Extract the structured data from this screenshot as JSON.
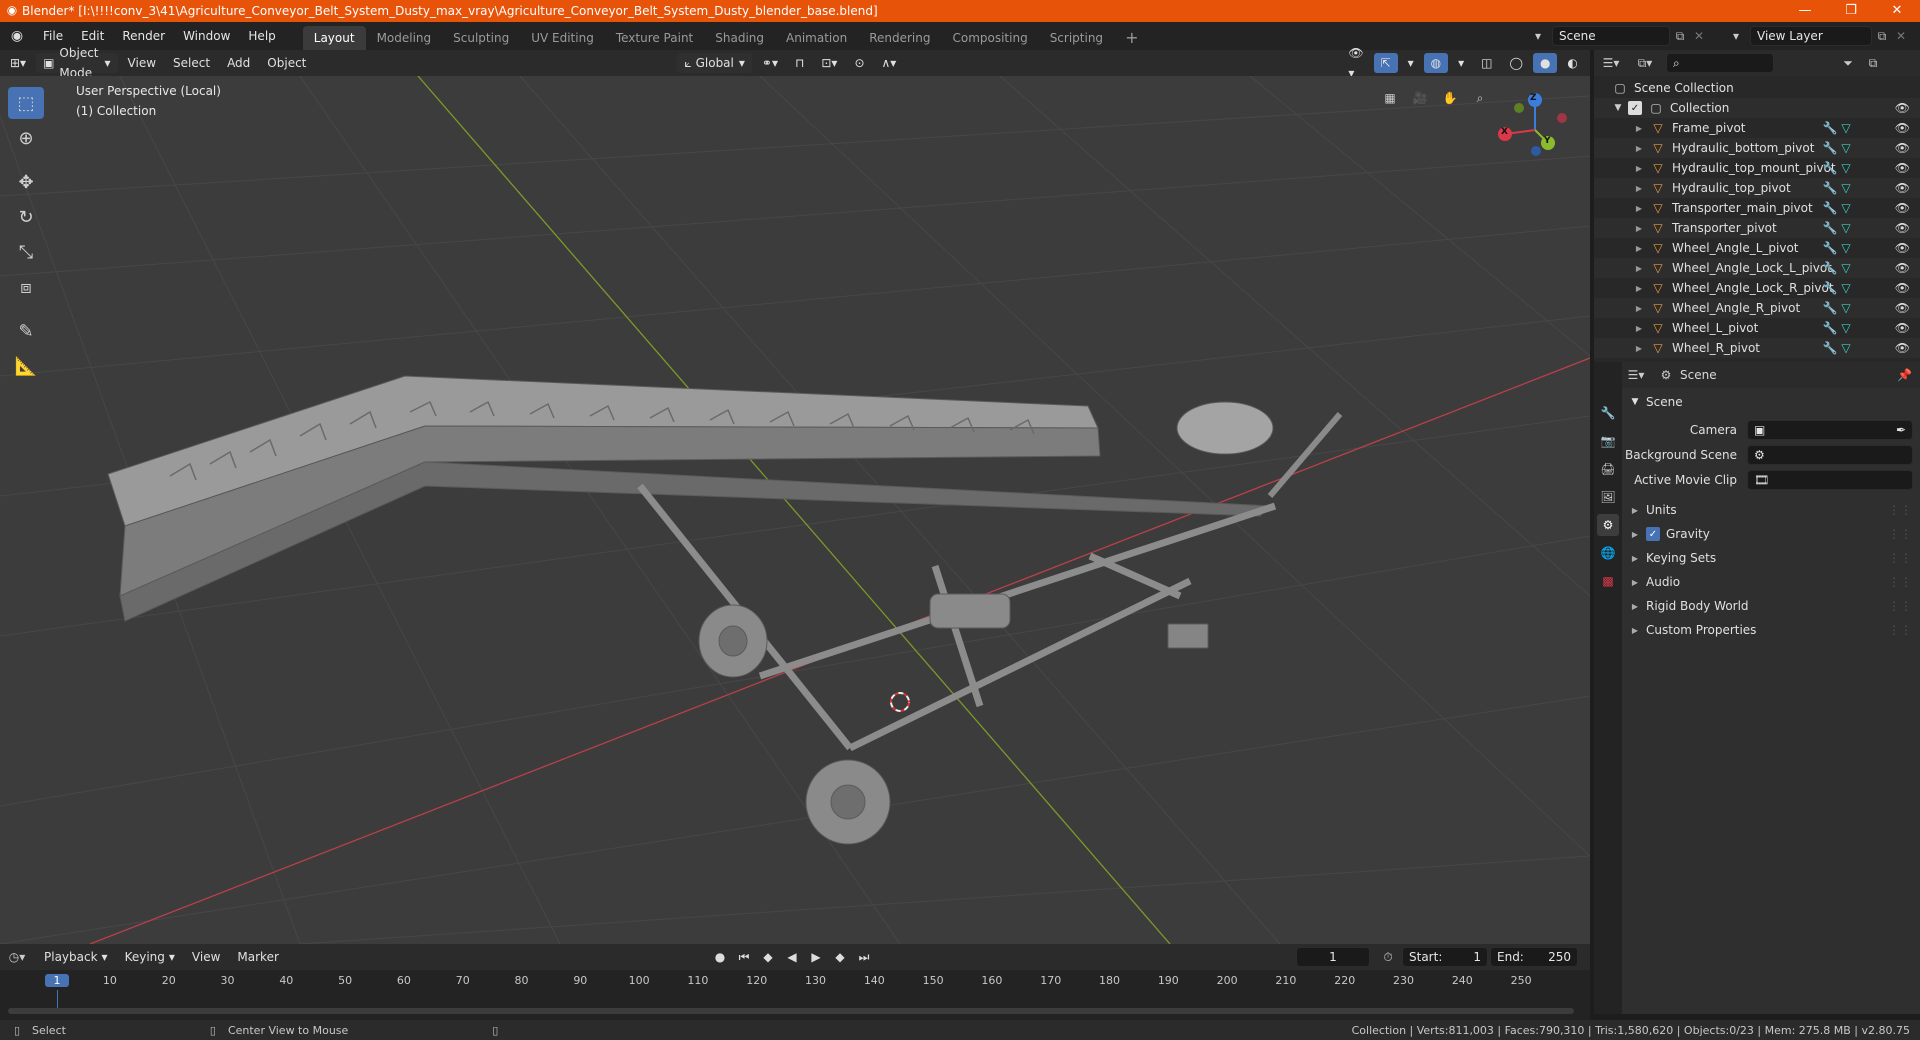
{
  "window": {
    "title": "Blender* [I:\\!!!!conv_3\\41\\Agriculture_Conveyor_Belt_System_Dusty_max_vray\\Agriculture_Conveyor_Belt_System_Dusty_blender_base.blend]",
    "minimize": "—",
    "restore": "❐",
    "close": "✕"
  },
  "menu": [
    "File",
    "Edit",
    "Render",
    "Window",
    "Help"
  ],
  "workspaces": [
    "Layout",
    "Modeling",
    "Sculpting",
    "UV Editing",
    "Texture Paint",
    "Shading",
    "Animation",
    "Rendering",
    "Compositing",
    "Scripting"
  ],
  "workspace_add": "+",
  "scene_field": "Scene",
  "view_layer_field": "View Layer",
  "viewport_header": {
    "mode": "Object Mode",
    "view": "View",
    "select": "Select",
    "add": "Add",
    "object": "Object",
    "transform": "Global"
  },
  "viewport": {
    "perspective": "User Perspective (Local)",
    "collection": "(1) Collection",
    "gizmo": {
      "x": "X",
      "y": "Y",
      "z": "Z"
    }
  },
  "outliner": {
    "root": "Scene Collection",
    "collection": "Collection",
    "items": [
      "Frame_pivot",
      "Hydraulic_bottom_pivot",
      "Hydraulic_top_mount_pivot",
      "Hydraulic_top_pivot",
      "Transporter_main_pivot",
      "Transporter_pivot",
      "Wheel_Angle_L_pivot",
      "Wheel_Angle_Lock_L_pivot",
      "Wheel_Angle_Lock_R_pivot",
      "Wheel_Angle_R_pivot",
      "Wheel_L_pivot",
      "Wheel_R_pivot"
    ]
  },
  "properties": {
    "header": "Scene",
    "panel": "Scene",
    "fields": [
      {
        "label": "Camera",
        "value": ""
      },
      {
        "label": "Background Scene",
        "value": ""
      },
      {
        "label": "Active Movie Clip",
        "value": ""
      }
    ],
    "sections": [
      "Units",
      "Gravity",
      "Keying Sets",
      "Audio",
      "Rigid Body World",
      "Custom Properties"
    ],
    "gravity_checked": true
  },
  "timeline": {
    "playback": "Playback",
    "keying": "Keying",
    "view": "View",
    "marker": "Marker",
    "current_frame": "1",
    "start_label": "Start:",
    "start": "1",
    "end_label": "End:",
    "end": "250",
    "ticks": [
      "1",
      "10",
      "20",
      "30",
      "40",
      "50",
      "60",
      "70",
      "80",
      "90",
      "100",
      "110",
      "120",
      "130",
      "140",
      "150",
      "160",
      "170",
      "180",
      "190",
      "200",
      "210",
      "220",
      "230",
      "240",
      "250"
    ]
  },
  "status": {
    "select": "Select",
    "center": "Center View to Mouse",
    "stats": "Collection | Verts:811,003 | Faces:790,310 | Tris:1,580,620 | Objects:0/23 | Mem: 275.8 MB | v2.80.75"
  },
  "colors": {
    "title_bar": "#e8530a",
    "accent": "#4772b3",
    "x_axis": "#d9394a",
    "y_axis": "#8cba2e",
    "z_axis": "#3b7ddd",
    "mesh_icon": "#e89a3c",
    "modifier_icon": "#6aa0ff",
    "data_icon": "#3ccfbf"
  }
}
